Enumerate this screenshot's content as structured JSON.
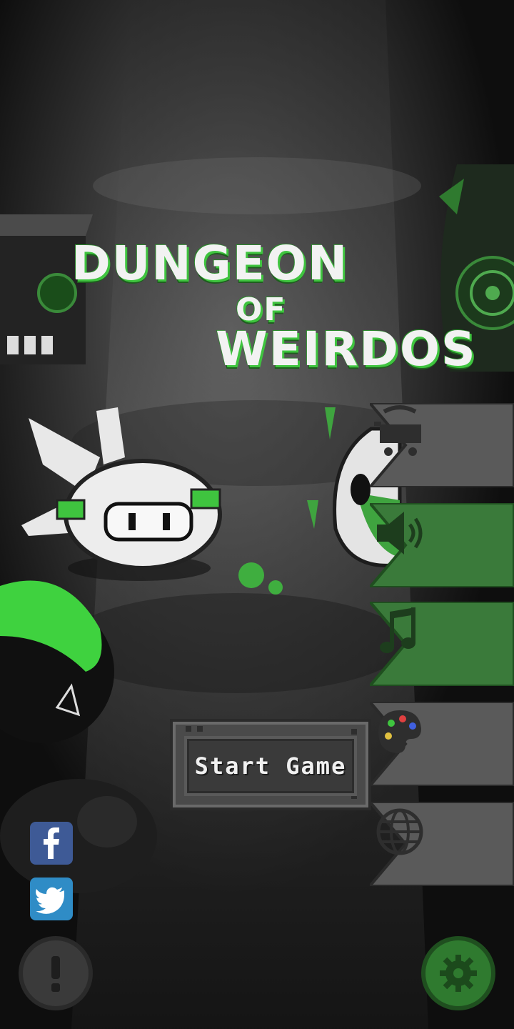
{
  "game": {
    "title_line1": "DUNGEON",
    "title_line2": "OF",
    "title_line3": "WEIRDOS"
  },
  "start_button": {
    "label": "Start Game"
  },
  "side_menu": [
    {
      "name": "shop",
      "icon": "shopping-cart-icon"
    },
    {
      "name": "sound",
      "icon": "speaker-icon"
    },
    {
      "name": "music",
      "icon": "music-note-icon"
    },
    {
      "name": "skins",
      "icon": "palette-icon"
    },
    {
      "name": "language",
      "icon": "globe-icon"
    }
  ],
  "social": [
    {
      "name": "facebook",
      "icon": "facebook-icon",
      "color": "#3e5a96"
    },
    {
      "name": "twitter",
      "icon": "twitter-icon",
      "color": "#2f8cc6"
    }
  ],
  "bottom": {
    "info_icon": "exclamation-icon",
    "settings_icon": "gear-icon"
  },
  "colors": {
    "accent_green": "#3fc43f",
    "panel_gray": "#4a4a4a",
    "panel_green": "#2f7a2f"
  }
}
